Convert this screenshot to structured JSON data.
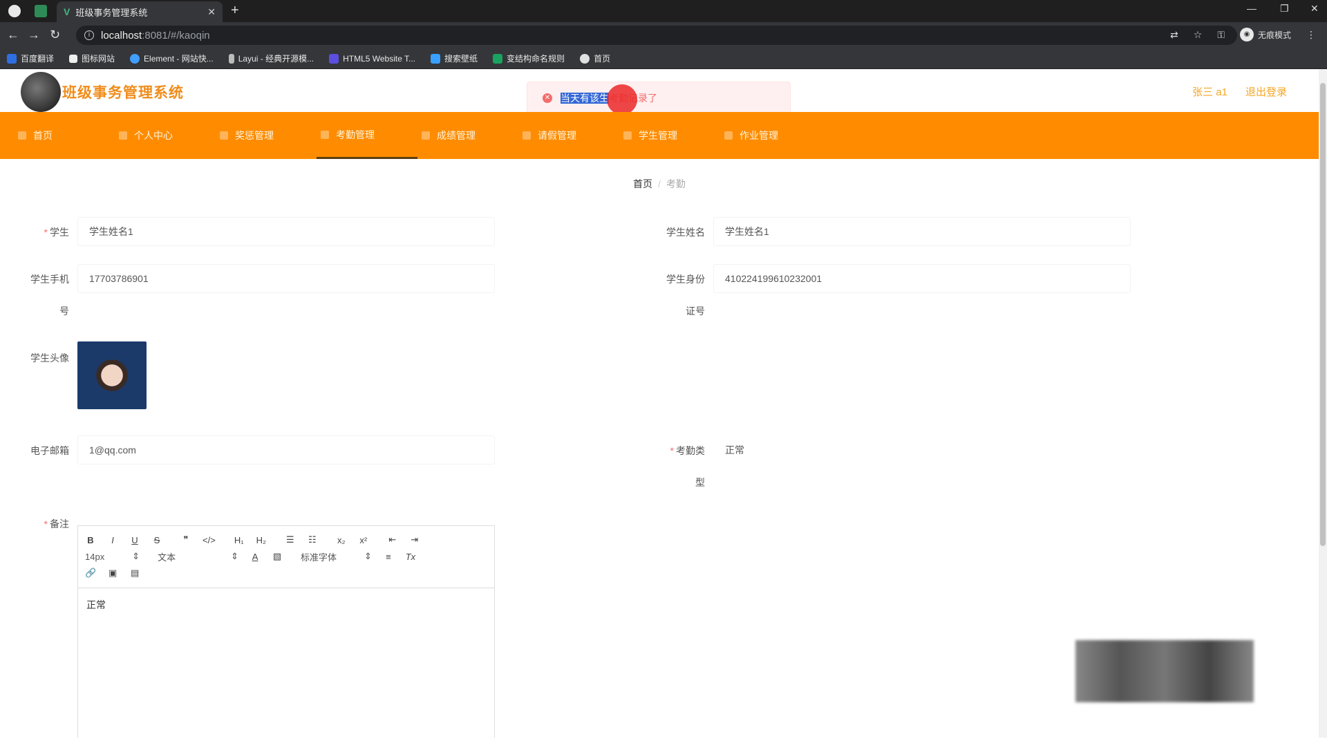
{
  "browser": {
    "tab_title": "班级事务管理系统",
    "url_host": "localhost",
    "url_path": ":8081/#/kaoqin",
    "incognito_label": "无痕模式",
    "bookmarks": [
      {
        "label": "百度翻译",
        "color": "#2f6fe4"
      },
      {
        "label": "图标网站",
        "color": "#ffffff"
      },
      {
        "label": "Element - 网站快...",
        "color": "#409eff"
      },
      {
        "label": "Layui - 经典开源模...",
        "color": "#ffffff"
      },
      {
        "label": "HTML5 Website T...",
        "color": "#5b4fe0"
      },
      {
        "label": "搜索壁纸",
        "color": "#3aa0ff"
      },
      {
        "label": "变结构命名规则",
        "color": "#1aa260"
      },
      {
        "label": "首页",
        "color": "#e0e0e0"
      }
    ]
  },
  "header": {
    "site_name": "班级事务管理系统",
    "user_label": "张三 a1",
    "logout_label": "退出登录"
  },
  "toast": {
    "selected_text": "当天有该生",
    "rest_text": "考勤记录了"
  },
  "menu": {
    "items": [
      {
        "label": "首页"
      },
      {
        "label": "个人中心"
      },
      {
        "label": "奖惩管理"
      },
      {
        "label": "考勤管理"
      },
      {
        "label": "成绩管理"
      },
      {
        "label": "请假管理"
      },
      {
        "label": "学生管理"
      },
      {
        "label": "作业管理"
      }
    ]
  },
  "breadcrumb": {
    "home": "首页",
    "current": "考勤"
  },
  "form": {
    "student_label": "学生",
    "student_value": "学生姓名1",
    "student_name_label": "学生姓名",
    "student_name_value": "学生姓名1",
    "phone_label_a": "学生手机",
    "phone_label_b": "号",
    "phone_value": "17703786901",
    "idcard_label_a": "学生身份",
    "idcard_label_b": "证号",
    "idcard_value": "410224199610232001",
    "avatar_label": "学生头像",
    "email_label": "电子邮箱",
    "email_value": "1@qq.com",
    "attendance_label_a": "考勤类",
    "attendance_label_b": "型",
    "attendance_value": "正常",
    "remark_label": "备注",
    "remark_value": "正常"
  },
  "editor": {
    "font_size": "14px",
    "format": "文本",
    "font_family": "标准字体"
  }
}
